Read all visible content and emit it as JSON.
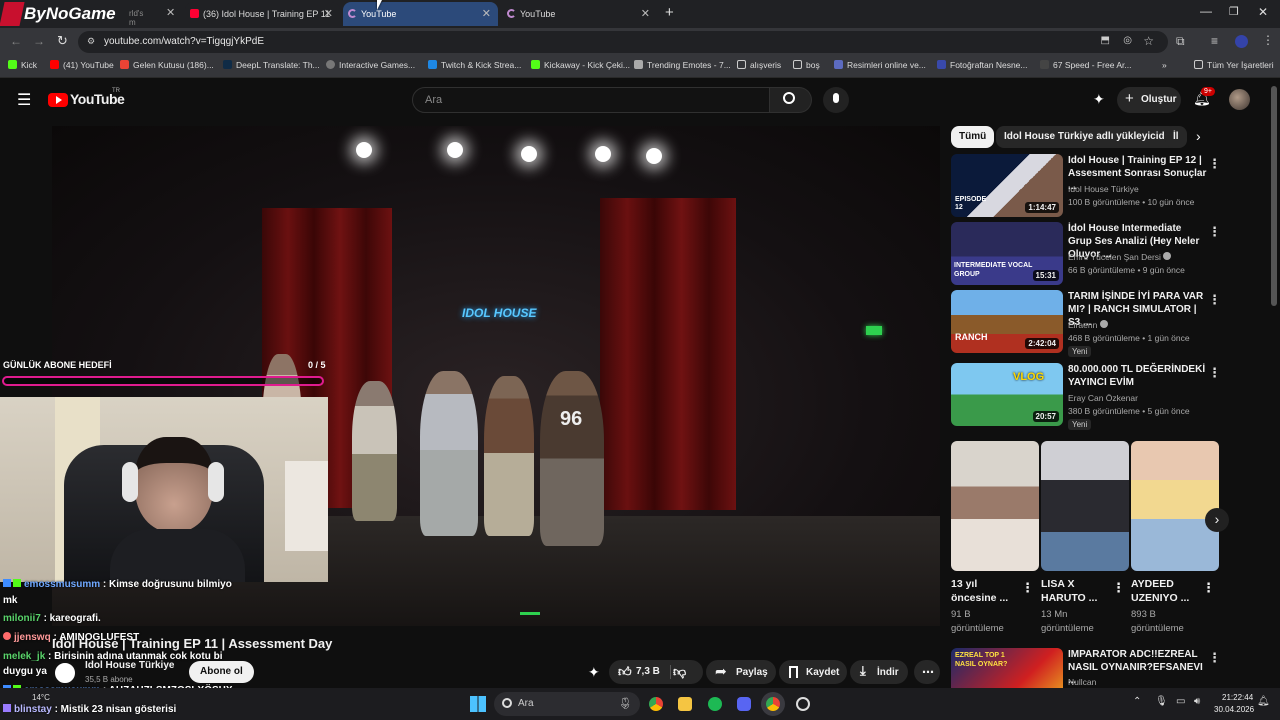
{
  "browser": {
    "tabs": [
      {
        "label": "ByNoGame",
        "sub": "rld's m"
      },
      {
        "label": "(36) Idol House | Training EP 11"
      },
      {
        "label": "YouTube",
        "active": true
      },
      {
        "label": "YouTube"
      }
    ],
    "url": "youtube.com/watch?v=TigqgjYkPdE",
    "bookmarks": [
      "Kick",
      "(41) YouTube",
      "Gelen Kutusu (186)...",
      "DeepL Translate: Th...",
      "Interactive Games...",
      "Twitch & Kick Strea...",
      "Kickaway - Kick Çeki...",
      "Trending Emotes - 7...",
      "alışveris",
      "boş",
      "Resimleri online ve...",
      "Fotoğraftan Nesne...",
      "67 Speed - Free Ar..."
    ],
    "all_bookmarks": "Tüm Yer İşaretleri"
  },
  "youtube": {
    "logo": "YouTube",
    "logo_sup": "TR",
    "search_placeholder": "Ara",
    "create_label": "Oluştur",
    "notif_count": "9+"
  },
  "overlay": {
    "goal_label": "GÜNLÜK ABONE HEDEFİ",
    "goal_count": "0 / 5",
    "goal_progress": 0,
    "chat": [
      {
        "user": "emossmusumm",
        "msg": ": Kimse doğrusunu bilmiyo",
        "cont": "mk",
        "color": "#6fa8ff"
      },
      {
        "user": "milonii7",
        "msg": ": kareografi.",
        "color": "#59d36a"
      },
      {
        "user": "jjenswq",
        "msg": ": AMINOGLUFEST",
        "color": "#ff9a9a"
      },
      {
        "user": "melek_jk",
        "msg": ": Birisinin adına utanmak cok kotu bi",
        "cont": "duygu ya",
        "color": "#59d36a"
      },
      {
        "user": "emossmusumm",
        "msg": ": AHZAHZLSMZOSLXÖSHX",
        "color": "#6fa8ff"
      },
      {
        "user": "blinstay",
        "msg": ": Mistik 23 nisan gösterisi",
        "color": "#b9b9ff"
      }
    ]
  },
  "video": {
    "title": "Idol House | Training EP 11 | Assessment Day",
    "channel": "Idol House Türkiye",
    "subs": "35,5 B abone",
    "subscribe": "Abone ol",
    "likes": "7,3 B",
    "share": "Paylaş",
    "save": "Kaydet",
    "download": "İndir",
    "sign_text": "IDOL HOUSE"
  },
  "chips": [
    "Tümü",
    "Idol House Türkiye adlı yükleyiciden",
    "İl"
  ],
  "recommended": [
    {
      "title": "Idol House | Training EP 12 | Assesment Sonrası Sonuçlar ...",
      "channel": "Idol House Türkiye",
      "meta": "100 B görüntüleme • 10 gün önce",
      "duration": "1:14:47",
      "thumb_text": "EPISODE 12"
    },
    {
      "title": "İdol House Intermediate Grup Ses Analizi (Hey Neler Oluyor ...",
      "channel": "Emre Yücelen Şan Dersi",
      "meta": "66 B görüntüleme • 9 gün önce",
      "duration": "15:31",
      "thumb_text": "INTERMEDIATE VOCAL GROUP"
    },
    {
      "title": "TARIM İŞİNDE İYİ PARA VAR MI? | RANCH SIMULATOR | S3 ...",
      "channel": "Elraenn",
      "meta": "468 B görüntüleme • 1 gün önce",
      "duration": "2:42:04",
      "badge": "Yeni",
      "thumb_text": "RANCH"
    },
    {
      "title": "80.000.000 TL DEĞERİNDEKİ YAYINCI EVİM",
      "channel": "Eray Can Özkenar",
      "meta": "380 B görüntüleme • 5 gün önce",
      "duration": "20:57",
      "badge": "Yeni",
      "thumb_text": "VLOG"
    }
  ],
  "shorts": [
    {
      "title": "13 yıl öncesine ...",
      "views": "91 B görüntüleme"
    },
    {
      "title": "LISA X HARUTO ...",
      "views": "13 Mn görüntüleme"
    },
    {
      "title": "AYDEED UZENIYO ...",
      "views": "893 B görüntüleme"
    }
  ],
  "next_video": {
    "title": "IMPARATOR ADC!!EZREAL NASIL OYNANIR?EFSANEVI ...",
    "channel": "Nullcan",
    "thumb_text": "EZREAL TOP 1 NASIL OYNAR?"
  },
  "taskbar": {
    "search": "Ara",
    "weather": "14°C",
    "time": "21:22:44",
    "date": "30.04.2026"
  },
  "colors": {
    "yt_red": "#ff0000",
    "goal_bar": "#e01b8f"
  }
}
